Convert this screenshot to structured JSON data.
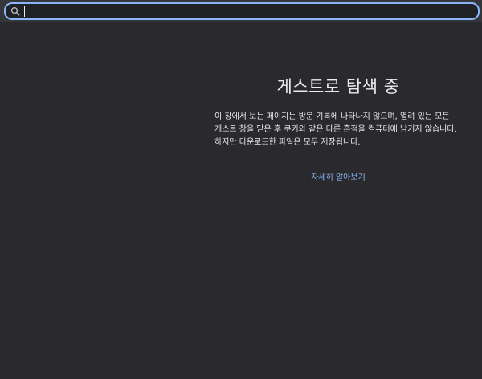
{
  "omnibox": {
    "value": "",
    "search_icon": "search-icon"
  },
  "guest_page": {
    "title": "게스트로 탐색 중",
    "description": "이 창에서 보는 페이지는 방문 기록에 나타나지 않으며, 열려 있는 모든 게스트 창을 닫은 후 쿠키와 같은 다른 흔적을 컴퓨터에 남기지 않습니다. 하지만 다운로드한 파일은 모두 저장됩니다.",
    "learn_more": "자세히 알아보기"
  },
  "colors": {
    "background": "#2a2a2e",
    "accent": "#8ab4f8",
    "text": "#e8eaed"
  }
}
